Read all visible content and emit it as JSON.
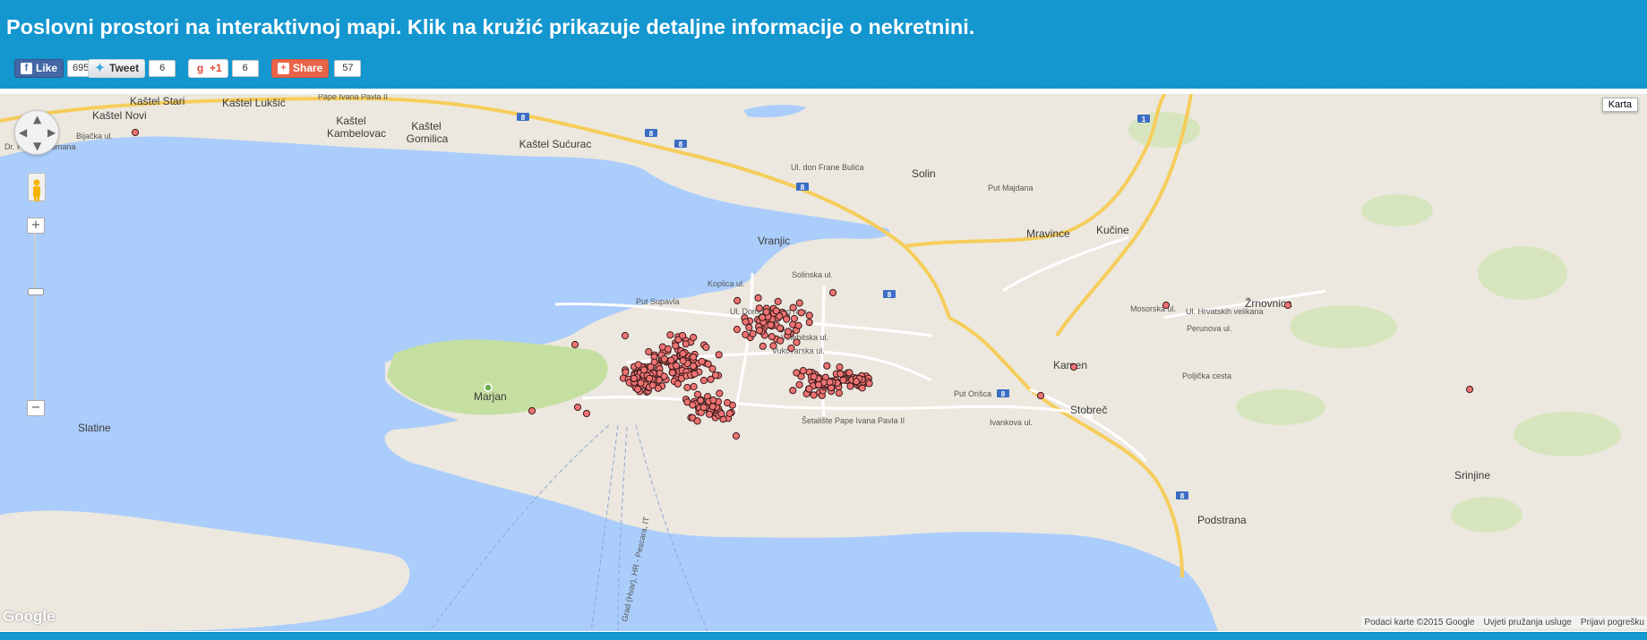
{
  "header": {
    "title": "Poslovni prostori na interaktivnoj mapi. Klik na kružić prikazuje detaljne informacije o nekretnini."
  },
  "social": {
    "facebook": {
      "label": "Like",
      "count": "695",
      "icon": "facebook-icon"
    },
    "twitter": {
      "label": "Tweet",
      "count": "6",
      "icon": "twitter-bird-icon"
    },
    "googleplus": {
      "label": "+1",
      "count": "6",
      "icon": "google-plus-icon"
    },
    "share": {
      "label": "Share",
      "count": "57",
      "icon": "plus-icon"
    }
  },
  "map": {
    "type_button": "Karta",
    "logo": "Google",
    "footer": {
      "data": "Podaci karte ©2015 Google",
      "terms": "Uvjeti pružanja usluge",
      "report": "Prijavi pogrešku"
    },
    "colors": {
      "water": "#abcdfb",
      "land": "#ece8df",
      "park": "#c5dfa1",
      "motorway": "#fbd564",
      "marker": "#ef7373"
    },
    "places": [
      "Kaštel Stari",
      "Kaštel Lukšić",
      "Kaštel Novi",
      "Kaštel Kambelovac",
      "Kaštel Gomilica",
      "Kaštel Sućurac",
      "Solin",
      "Vranjic",
      "Mravince",
      "Kučine",
      "Žrnovnica",
      "Kamen",
      "Stobreč",
      "Marjan",
      "Slatine",
      "Srinjine",
      "Podstrana"
    ],
    "streets": [
      "Put Supavla",
      "Koplica ul.",
      "Solinska ul.",
      "Ul. Domovinskog rata",
      "Velebitska ul.",
      "Vukovarska ul.",
      "Put Orišca",
      "Ivankova ul.",
      "Šetalište Pape Ivana Pavla II",
      "Ul. don Frane Bulića",
      "Put Majdana",
      "Mosorska ul.",
      "Ul. Hrvatskih velikana",
      "Perunova ul.",
      "Poljička cesta",
      "Bijačka ul.",
      "Dr. Franje Tuđmana",
      "Pape Ivana Pavla II",
      "Grad (Hvar), HR - Pescara, IT"
    ],
    "route_shields": [
      "8",
      "1"
    ],
    "marker_count": 420
  }
}
